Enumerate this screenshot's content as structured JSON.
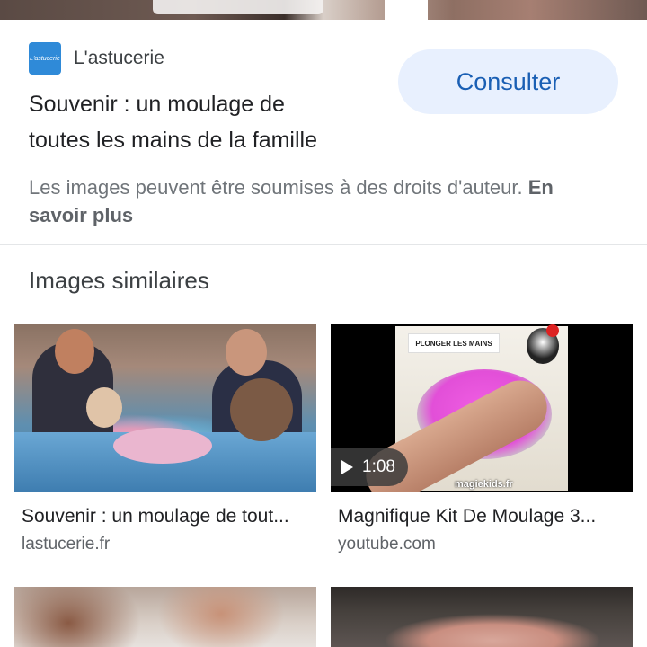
{
  "source": {
    "favicon_text": "L'astucerie",
    "name": "L'astucerie"
  },
  "visit_button": "Consulter",
  "title_line1": "Souvenir : un moulage de",
  "title_line2": "toutes les mains de la famille",
  "copyright": {
    "text": "Les images peuvent être soumises à des droits d'auteur. ",
    "link": "En savoir plus"
  },
  "similar": {
    "heading": "Images similaires",
    "items": [
      {
        "title": "Souvenir : un moulage de tout...",
        "domain": "lastucerie.fr"
      },
      {
        "title": "Magnifique Kit De Moulage 3...",
        "domain": "youtube.com",
        "duration": "1:08",
        "overlay_label": "PLONGER LES MAINS",
        "watermark": "magiekids.fr"
      }
    ]
  },
  "colors": {
    "accent": "#1a5fb4",
    "button_bg": "#e8f0fe",
    "favicon_bg": "#2f8ad8"
  }
}
